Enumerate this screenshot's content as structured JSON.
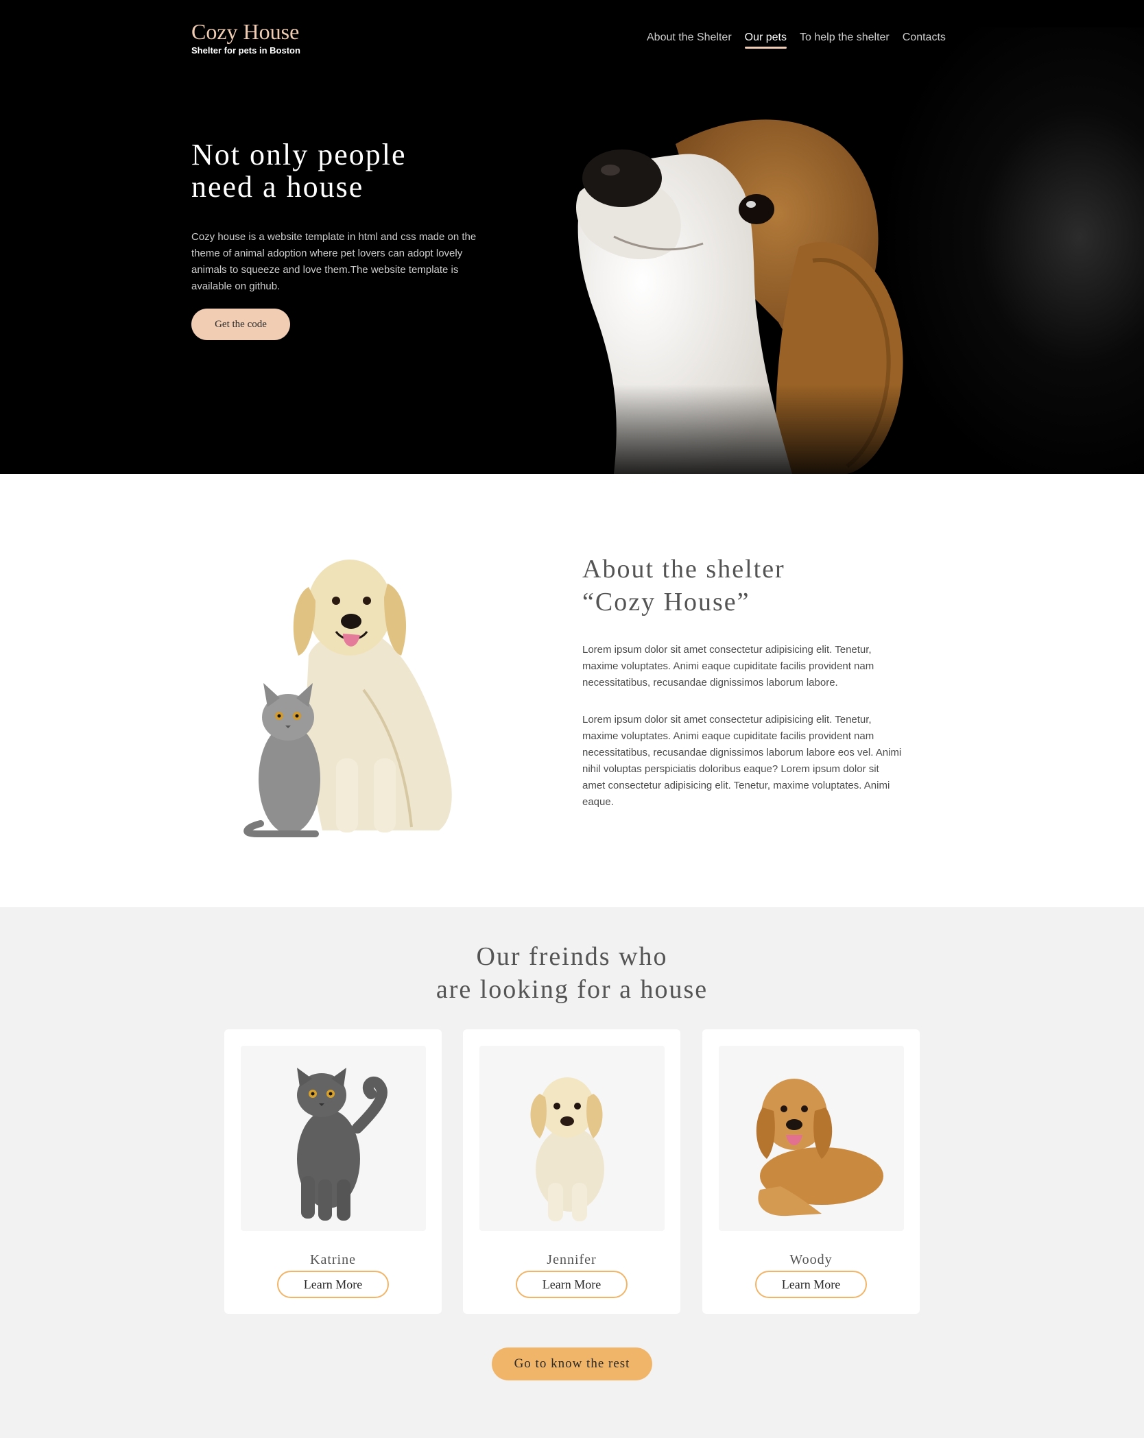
{
  "header": {
    "logo_title": "Cozy House",
    "logo_subtitle": "Shelter for pets in Boston",
    "nav": [
      {
        "label": "About the Shelter",
        "active": false
      },
      {
        "label": "Our pets",
        "active": true
      },
      {
        "label": "To help the shelter",
        "active": false
      },
      {
        "label": "Contacts",
        "active": false
      }
    ]
  },
  "hero": {
    "title_line1": "Not only people",
    "title_line2": "need a house",
    "text": "Cozy house is a website template in html and css made on the theme of animal adoption where pet lovers can adopt lovely animals to squeeze and love them.The website template is available on github.",
    "button_label": "Get the code",
    "image_icon": "beagle-puppy-photo"
  },
  "about": {
    "title_line1": "About the shelter",
    "title_line2": "“Cozy House”",
    "paragraph1": "Lorem ipsum dolor sit amet consectetur adipisicing elit. Tenetur, maxime voluptates. Animi eaque cupiditate facilis provident nam necessitatibus, recusandae dignissimos laborum labore.",
    "paragraph2": "Lorem ipsum dolor sit amet consectetur adipisicing elit. Tenetur, maxime voluptates. Animi eaque cupiditate facilis provident nam necessitatibus, recusandae dignissimos laborum labore eos vel. Animi nihil voluptas perspiciatis doloribus eaque? Lorem ipsum dolor sit amet consectetur adipisicing elit. Tenetur, maxime voluptates. Animi eaque.",
    "image_icon": "dog-and-cat-photo"
  },
  "pets": {
    "title_line1": "Our freinds who",
    "title_line2": "are looking for a house",
    "cards": [
      {
        "name": "Katrine",
        "button_label": "Learn More",
        "image_icon": "grey-cat-photo"
      },
      {
        "name": "Jennifer",
        "button_label": "Learn More",
        "image_icon": "white-puppy-photo"
      },
      {
        "name": "Woody",
        "button_label": "Learn More",
        "image_icon": "golden-retriever-photo"
      }
    ],
    "more_button_label": "Go to know the rest"
  },
  "colors": {
    "accent": "#f1cdb3",
    "accent_dark": "#f1b56a",
    "hero_bg": "#000000",
    "pets_bg": "#f2f2f2"
  }
}
